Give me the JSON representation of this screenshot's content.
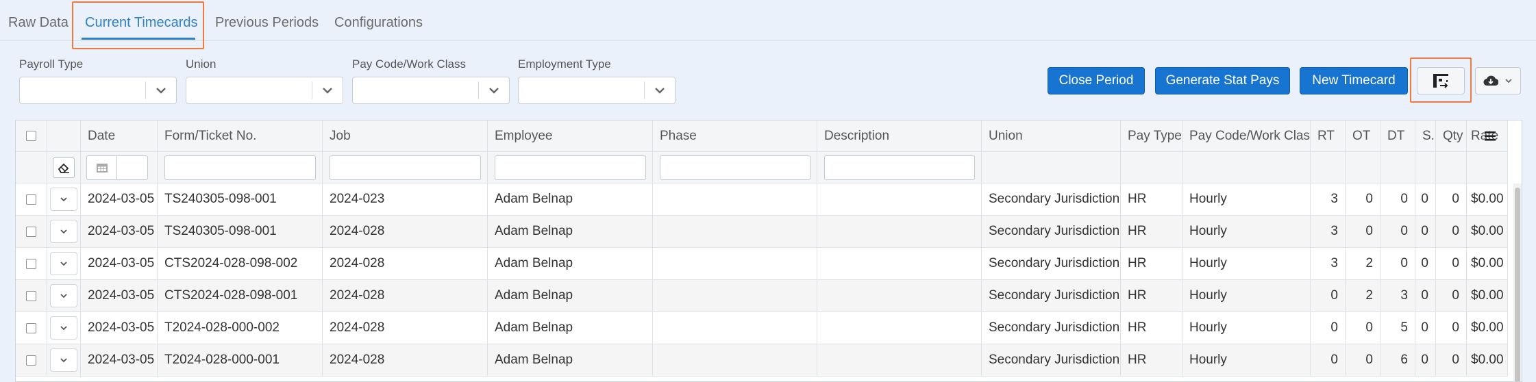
{
  "tabs": [
    {
      "label": "Raw Data",
      "active": false
    },
    {
      "label": "Current Timecards",
      "active": true
    },
    {
      "label": "Previous Periods",
      "active": false
    },
    {
      "label": "Configurations",
      "active": false
    }
  ],
  "filters": {
    "payroll_type": {
      "label": "Payroll Type",
      "value": ""
    },
    "union": {
      "label": "Union",
      "value": ""
    },
    "pay_code": {
      "label": "Pay Code/Work Class",
      "value": ""
    },
    "employment_type": {
      "label": "Employment Type",
      "value": ""
    }
  },
  "toolbar": {
    "close_period": "Close Period",
    "generate_stat_pays": "Generate Stat Pays",
    "new_timecard": "New Timecard",
    "column_chooser_icon": "column-chooser-icon",
    "cloud_download_icon": "cloud-download-icon"
  },
  "grid": {
    "columns": [
      "Date",
      "Form/Ticket No.",
      "Job",
      "Employee",
      "Phase",
      "Description",
      "Union",
      "Pay Type",
      "Pay Code/Work Class",
      "RT",
      "OT",
      "DT",
      "S..",
      "Qty",
      "Rate"
    ],
    "rows": [
      {
        "date": "2024-03-05",
        "ticket": "TS240305-098-001",
        "job": "2024-023",
        "employee": "Adam Belnap",
        "phase": "",
        "description": "",
        "union": "Secondary Jurisdiction",
        "pay_type": "HR",
        "pay_code": "Hourly",
        "rt": "3",
        "ot": "0",
        "dt": "0",
        "s": "0",
        "qty": "0",
        "rate": "$0.00"
      },
      {
        "date": "2024-03-05",
        "ticket": "TS240305-098-001",
        "job": "2024-028",
        "employee": "Adam Belnap",
        "phase": "",
        "description": "",
        "union": "Secondary Jurisdiction",
        "pay_type": "HR",
        "pay_code": "Hourly",
        "rt": "3",
        "ot": "0",
        "dt": "0",
        "s": "0",
        "qty": "0",
        "rate": "$0.00"
      },
      {
        "date": "2024-03-05",
        "ticket": "CTS2024-028-098-002",
        "job": "2024-028",
        "employee": "Adam Belnap",
        "phase": "",
        "description": "",
        "union": "Secondary Jurisdiction",
        "pay_type": "HR",
        "pay_code": "Hourly",
        "rt": "3",
        "ot": "2",
        "dt": "0",
        "s": "0",
        "qty": "0",
        "rate": "$0.00"
      },
      {
        "date": "2024-03-05",
        "ticket": "CTS2024-028-098-001",
        "job": "2024-028",
        "employee": "Adam Belnap",
        "phase": "",
        "description": "",
        "union": "Secondary Jurisdiction",
        "pay_type": "HR",
        "pay_code": "Hourly",
        "rt": "0",
        "ot": "2",
        "dt": "3",
        "s": "0",
        "qty": "0",
        "rate": "$0.00"
      },
      {
        "date": "2024-03-05",
        "ticket": "T2024-028-000-002",
        "job": "2024-028",
        "employee": "Adam Belnap",
        "phase": "",
        "description": "",
        "union": "Secondary Jurisdiction",
        "pay_type": "HR",
        "pay_code": "Hourly",
        "rt": "0",
        "ot": "0",
        "dt": "5",
        "s": "0",
        "qty": "0",
        "rate": "$0.00"
      },
      {
        "date": "2024-03-05",
        "ticket": "T2024-028-000-001",
        "job": "2024-028",
        "employee": "Adam Belnap",
        "phase": "",
        "description": "",
        "union": "Secondary Jurisdiction",
        "pay_type": "HR",
        "pay_code": "Hourly",
        "rt": "0",
        "ot": "0",
        "dt": "6",
        "s": "0",
        "qty": "0",
        "rate": "$0.00"
      }
    ]
  }
}
